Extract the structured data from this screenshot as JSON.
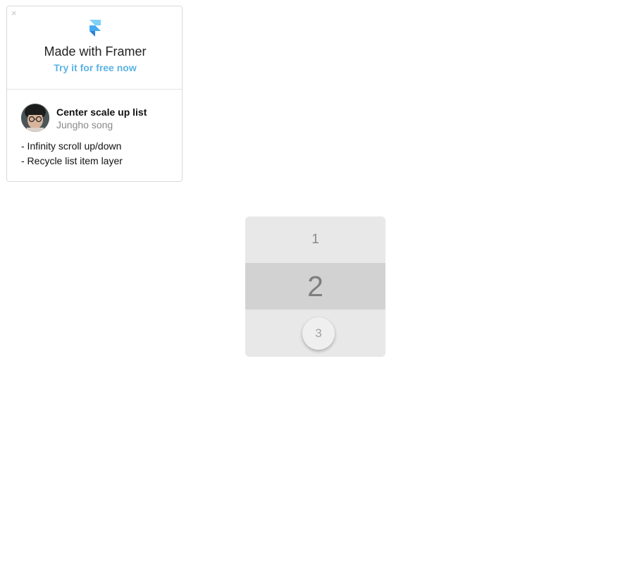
{
  "card": {
    "close_icon": "×",
    "logo_icon": "framer-logo-icon",
    "title": "Made with Framer",
    "link": "Try it for free now",
    "project_title": "Center scale up list",
    "project_author": "Jungho song",
    "description": [
      "- Infinity scroll up/down",
      "- Recycle list item layer"
    ]
  },
  "picker": {
    "items": [
      "1",
      "2",
      "3"
    ],
    "selected": "2"
  },
  "colors": {
    "link": "#5bb3e5",
    "logo_light": "#7fd0f5",
    "logo_dark": "#2a8fe0",
    "picker_bg": "#e8e8e8",
    "picker_selected_bg": "#d2d2d2"
  }
}
